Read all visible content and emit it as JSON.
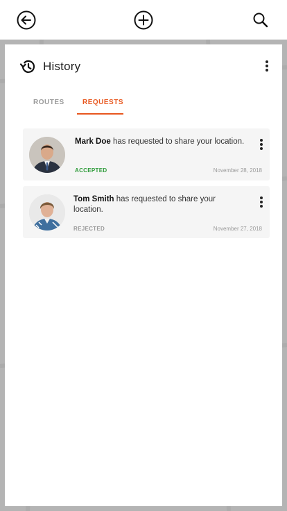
{
  "topbar": {
    "back_icon": "arrow-left-circle-icon",
    "add_icon": "plus-circle-icon",
    "search_icon": "search-icon"
  },
  "history": {
    "title": "History",
    "icon": "history-icon",
    "menu_icon": "more-vertical-icon"
  },
  "tabs": [
    {
      "label": "ROUTES",
      "active": false
    },
    {
      "label": "REQUESTS",
      "active": true
    }
  ],
  "requests": [
    {
      "name": "Mark Doe",
      "message": " has requested to share your location.",
      "status": "ACCEPTED",
      "date": "November 28, 2018"
    },
    {
      "name": "Tom Smith",
      "message": " has requested to share your location.",
      "status": "REJECTED",
      "date": "November 27, 2018"
    }
  ],
  "colors": {
    "accent": "#e8571e",
    "accepted": "#2e9b3a",
    "muted": "#9a9a9a",
    "card_bg": "#f5f5f5",
    "backdrop": "#b4b4b4"
  }
}
